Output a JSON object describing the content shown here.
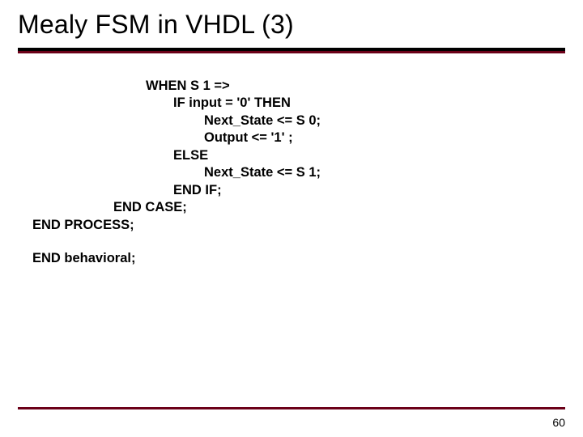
{
  "title": "Mealy FSM in VHDL (3)",
  "code": {
    "l1": "WHEN S 1 =>",
    "l2": "IF input = '0' THEN",
    "l3": "Next_State <= S 0;",
    "l4": "Output <= '1' ;",
    "l5": "ELSE",
    "l6": "Next_State <= S 1;",
    "l7": "END IF;",
    "l8": "END CASE;",
    "l9": "END PROCESS;",
    "l10": "END behavioral;"
  },
  "page_number": "60"
}
